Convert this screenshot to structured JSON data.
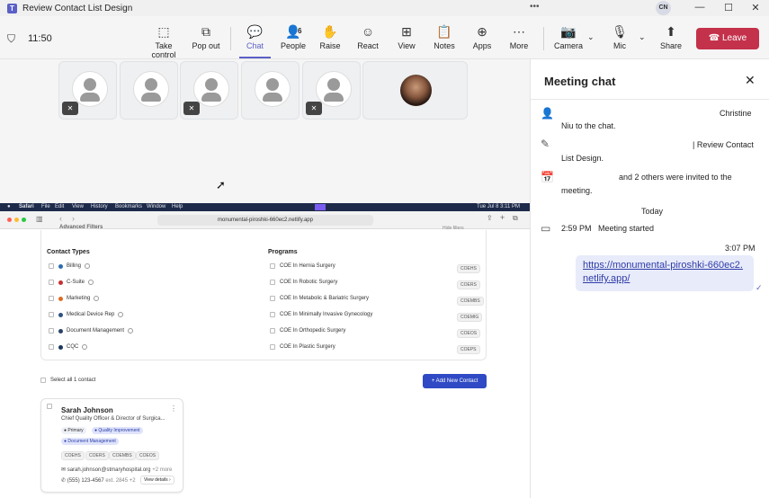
{
  "titlebar": {
    "title": "Review Contact List Design",
    "dots": "•••",
    "avatar": "CN",
    "minimize": "—",
    "maximize": "☐",
    "close": "✕"
  },
  "meeting": {
    "timer": "11:50",
    "toolbar": [
      {
        "label": "Take control",
        "icon": "take-control-icon",
        "glyph": "⬚"
      },
      {
        "label": "Pop out",
        "icon": "pop-out-icon",
        "glyph": "⧉"
      },
      {
        "label": "Chat",
        "icon": "chat-icon",
        "glyph": "💬"
      },
      {
        "label": "People",
        "icon": "people-icon",
        "glyph": "👤"
      },
      {
        "label": "Raise",
        "icon": "raise-hand-icon",
        "glyph": "✋"
      },
      {
        "label": "React",
        "icon": "react-icon",
        "glyph": "☺"
      },
      {
        "label": "View",
        "icon": "view-icon",
        "glyph": "⊞"
      },
      {
        "label": "Notes",
        "icon": "notes-icon",
        "glyph": "📋"
      },
      {
        "label": "Apps",
        "icon": "apps-icon",
        "glyph": "⊕"
      },
      {
        "label": "More",
        "icon": "more-icon",
        "glyph": "⋯"
      },
      {
        "label": "Camera",
        "icon": "camera-off-icon",
        "glyph": "📷"
      },
      {
        "label": "Mic",
        "icon": "mic-icon",
        "glyph": "🎙"
      },
      {
        "label": "Share",
        "icon": "share-icon",
        "glyph": "⬆"
      }
    ],
    "people_count": "6",
    "leave_label": "Leave"
  },
  "shared_screen": {
    "menubar": {
      "app": "Safari",
      "items": [
        "File",
        "Edit",
        "View",
        "History",
        "Bookmarks",
        "Window",
        "Help"
      ],
      "clock": "Tue Jul 8  3:11 PM"
    },
    "url": "monumental-piroshki-660ec2.netlify.app",
    "filters_title": "Advanced Filters",
    "hide_filters": "Hide filters",
    "contact_types_title": "Contact Types",
    "contact_types": [
      {
        "label": "Billing",
        "color": "#2b6cb0"
      },
      {
        "label": "C-Suite",
        "color": "#c53030"
      },
      {
        "label": "Marketing",
        "color": "#dd6b20"
      },
      {
        "label": "Medical Device Rep",
        "color": "#2c5282"
      },
      {
        "label": "Document Management",
        "color": "#2a4365"
      },
      {
        "label": "CQC",
        "color": "#1a365d"
      }
    ],
    "programs_title": "Programs",
    "programs": [
      {
        "label": "COE In Hernia Surgery",
        "code": "COEHS"
      },
      {
        "label": "COE In Robotic Surgery",
        "code": "COERS"
      },
      {
        "label": "COE In Metabolic & Bariatric Surgery",
        "code": "COEMBS"
      },
      {
        "label": "COE In Minimally Invasive Gynecology",
        "code": "COEMIG"
      },
      {
        "label": "COE In Orthopedic Surgery",
        "code": "COEOS"
      },
      {
        "label": "COE In Plastic Surgery",
        "code": "COEPS"
      }
    ],
    "select_all": "Select all 1 contact",
    "add_button": "+ Add New Contact",
    "card": {
      "name": "Sarah Johnson",
      "title": "Chief Quality Officer & Director of Surgica...",
      "tags": [
        "Primary",
        "Quality Improvement",
        "Document Management"
      ],
      "codes": [
        "COEHS",
        "COERS",
        "COEMBS",
        "COEOS"
      ],
      "email": "sarah.johnson@stmaryhospital.org",
      "more": "+2 more",
      "phone": "(555) 123-4567",
      "ext": "ext. 2845",
      "ext_more": "+2",
      "view_details": "View details"
    }
  },
  "chat": {
    "title": "Meeting chat",
    "events": [
      {
        "line1": "Christine",
        "line2": "Niu to the chat."
      },
      {
        "line1": "| Review Contact",
        "line2": "List Design."
      },
      {
        "line1": "and 2 others were invited to the",
        "line2": "meeting."
      }
    ],
    "day_label": "Today",
    "started_time": "2:59 PM",
    "started_text": "Meeting started",
    "msg_time": "3:07 PM",
    "msg_link": "https://monumental-piroshki-660ec2.netlify.app/"
  }
}
